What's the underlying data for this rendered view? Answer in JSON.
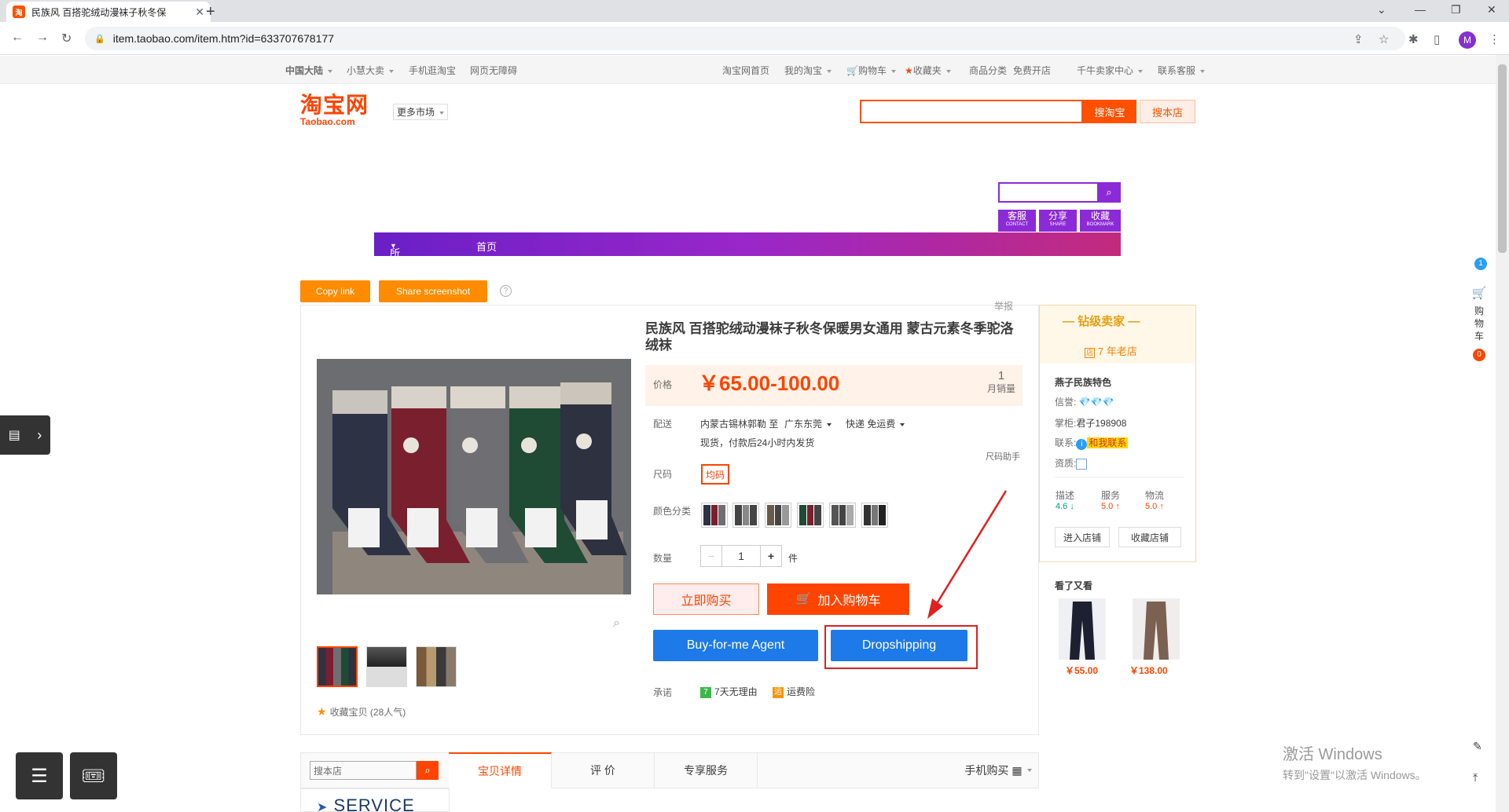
{
  "browser": {
    "tab_title": "民族风 百搭驼绒动漫袜子秋冬保",
    "url": "item.taobao.com/item.htm?id=633707678177",
    "profile_initial": "M"
  },
  "site_nav": {
    "region": "中国大陆",
    "xiaohui": "小慧大卖",
    "mobile": "手机逛淘宝",
    "accessible": "网页无障碍",
    "home": "淘宝网首页",
    "my_taobao": "我的淘宝",
    "cart": "购物车",
    "favorites": "收藏夹",
    "categories": "商品分类",
    "free_shop": "免费开店",
    "seller_center": "千牛卖家中心",
    "service": "联系客服"
  },
  "header": {
    "logo_cn": "淘宝网",
    "logo_en": "Taobao.com",
    "more_markets": "更多市场",
    "search_taobao": "搜淘宝",
    "search_shop": "搜本店"
  },
  "shop": {
    "buttons": [
      {
        "cn": "客服",
        "en": "CONTACT"
      },
      {
        "cn": "分享",
        "en": "SHARE"
      },
      {
        "cn": "收藏",
        "en": "BOOKMARK"
      }
    ],
    "nav_all": "所有分类",
    "nav_home": "首页"
  },
  "actions": {
    "copy_link": "Copy link",
    "share_screenshot": "Share screenshot",
    "report": "举报"
  },
  "product": {
    "title": "民族风 百搭驼绒动漫袜子秋冬保暖男女通用 蒙古元素冬季驼洛绒袜",
    "price_label": "价格",
    "price": "￥65.00-100.00",
    "monthly_sales": "1",
    "monthly_sales_label": "月销量",
    "delivery_label": "配送",
    "delivery_from": "内蒙古锡林郭勒 至",
    "delivery_to": "广东东莞",
    "shipping": "快递 免运费",
    "stock_note": "现货，付款后24小时内发货",
    "size_helper": "尺码助手",
    "size_label": "尺码",
    "size_value": "均码",
    "color_label": "颜色分类",
    "qty_label": "数量",
    "qty_value": "1",
    "qty_unit": "件",
    "qty_minus": "−",
    "qty_plus": "+",
    "buy_now": "立即购买",
    "add_cart": "加入购物车",
    "buy_for_me": "Buy-for-me Agent",
    "dropshipping": "Dropshipping",
    "promise_label": "承诺",
    "promise_1": "7天无理由",
    "promise_2": "运费险",
    "favorite": "收藏宝贝 (28人气)"
  },
  "seller": {
    "level": "钻级卖家",
    "years": "7 年老店",
    "name": "燕子民族特色",
    "credit_label": "信誉:",
    "credit_icons": "💎💎💎",
    "keeper_label": "掌柜:",
    "keeper": "君子198908",
    "contact_label": "联系:",
    "contact": "和我联系",
    "qual_label": "资质:",
    "scores": [
      {
        "label": "描述",
        "value": "4.6 ↓"
      },
      {
        "label": "服务",
        "value": "5.0 ↑"
      },
      {
        "label": "物流",
        "value": "5.0 ↑"
      }
    ],
    "enter_shop": "进入店铺",
    "fav_shop": "收藏店铺",
    "also_viewed": "看了又看",
    "rec_prices": [
      "￥55.00",
      "￥138.00"
    ]
  },
  "tabs": {
    "search_placeholder": "搜本店",
    "details": "宝贝详情",
    "reviews": "评 价",
    "services": "专享服务",
    "mobile_buy": "手机购买",
    "service_banner": "SERVICE"
  },
  "right_sidebar": {
    "cart_label": "购物车",
    "cart_count": "0",
    "msg_count": "1"
  },
  "watermark": {
    "line1": "激活 Windows",
    "line2": "转到\"设置\"以激活 Windows。"
  }
}
